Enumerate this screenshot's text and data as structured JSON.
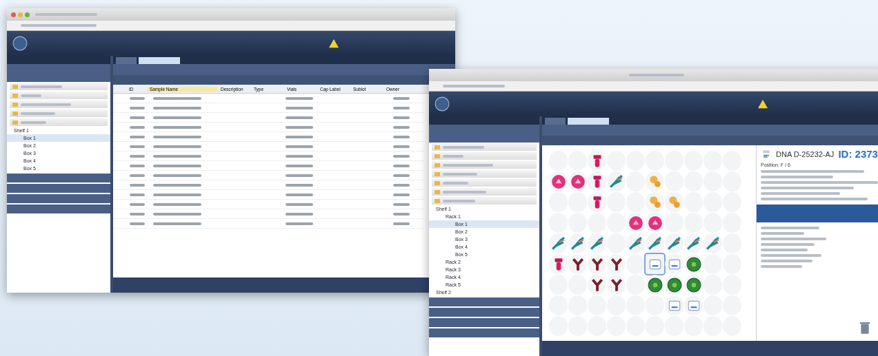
{
  "left_window": {
    "table": {
      "columns": [
        "ID",
        "Sample Name",
        "Description",
        "Type",
        "Vials",
        "Cap Label",
        "Sublot",
        "Owner"
      ]
    },
    "tree": [
      {
        "label": "Shelf 1",
        "children": [
          {
            "label": "Box 1",
            "selected": true
          },
          {
            "label": "Box 2",
            "selected": false
          },
          {
            "label": "Box 3",
            "selected": false
          },
          {
            "label": "Box 4",
            "selected": false
          },
          {
            "label": "Box 5",
            "selected": false
          }
        ]
      }
    ]
  },
  "right_window": {
    "tree": [
      {
        "label": "Shelf 1",
        "children": [
          {
            "label": "Rack 1",
            "children": [
              {
                "label": "Box 1",
                "selected": true
              },
              {
                "label": "Box 2",
                "selected": false
              },
              {
                "label": "Box 3",
                "selected": false
              },
              {
                "label": "Box 4",
                "selected": false
              },
              {
                "label": "Box 5",
                "selected": false
              }
            ]
          },
          {
            "label": "Rack 2"
          },
          {
            "label": "Rack 3"
          },
          {
            "label": "Rack 4"
          },
          {
            "label": "Rack 5"
          }
        ]
      },
      {
        "label": "Shelf 2"
      }
    ],
    "wells": [
      [
        {
          "kind": "empty",
          "selected": false
        },
        {
          "kind": "empty",
          "selected": false
        },
        {
          "kind": "tube",
          "selected": false
        },
        {
          "kind": "empty",
          "selected": false
        },
        {
          "kind": "empty",
          "selected": false
        },
        {
          "kind": "empty",
          "selected": false
        },
        {
          "kind": "empty",
          "selected": false
        },
        {
          "kind": "empty",
          "selected": false
        },
        {
          "kind": "empty",
          "selected": false
        },
        {
          "kind": "empty",
          "selected": false
        }
      ],
      [
        {
          "kind": "ball",
          "selected": false
        },
        {
          "kind": "ball",
          "selected": false
        },
        {
          "kind": "tube",
          "selected": false
        },
        {
          "kind": "leaf",
          "selected": false
        },
        {
          "kind": "empty",
          "selected": false
        },
        {
          "kind": "seed",
          "selected": false
        },
        {
          "kind": "empty",
          "selected": false
        },
        {
          "kind": "empty",
          "selected": false
        },
        {
          "kind": "empty",
          "selected": false
        },
        {
          "kind": "empty",
          "selected": false
        }
      ],
      [
        {
          "kind": "empty",
          "selected": false
        },
        {
          "kind": "empty",
          "selected": false
        },
        {
          "kind": "tube",
          "selected": false
        },
        {
          "kind": "empty",
          "selected": false
        },
        {
          "kind": "empty",
          "selected": false
        },
        {
          "kind": "seed",
          "selected": false
        },
        {
          "kind": "seed",
          "selected": false
        },
        {
          "kind": "empty",
          "selected": false
        },
        {
          "kind": "empty",
          "selected": false
        },
        {
          "kind": "empty",
          "selected": false
        }
      ],
      [
        {
          "kind": "empty",
          "selected": false
        },
        {
          "kind": "empty",
          "selected": false
        },
        {
          "kind": "empty",
          "selected": false
        },
        {
          "kind": "empty",
          "selected": false
        },
        {
          "kind": "ball",
          "selected": false
        },
        {
          "kind": "ball",
          "selected": false
        },
        {
          "kind": "empty",
          "selected": false
        },
        {
          "kind": "empty",
          "selected": false
        },
        {
          "kind": "empty",
          "selected": false
        },
        {
          "kind": "empty",
          "selected": false
        }
      ],
      [
        {
          "kind": "leaf",
          "selected": false
        },
        {
          "kind": "leaf",
          "selected": false
        },
        {
          "kind": "leaf",
          "selected": false
        },
        {
          "kind": "empty",
          "selected": false
        },
        {
          "kind": "leaf",
          "selected": false
        },
        {
          "kind": "leaf",
          "selected": false
        },
        {
          "kind": "leaf",
          "selected": false
        },
        {
          "kind": "leaf",
          "selected": false
        },
        {
          "kind": "leaf",
          "selected": false
        },
        {
          "kind": "empty",
          "selected": false
        }
      ],
      [
        {
          "kind": "tube",
          "selected": false
        },
        {
          "kind": "antibody",
          "selected": false
        },
        {
          "kind": "antibody",
          "selected": false
        },
        {
          "kind": "antibody",
          "selected": false
        },
        {
          "kind": "empty",
          "selected": false
        },
        {
          "kind": "label",
          "selected": true
        },
        {
          "kind": "label",
          "selected": false
        },
        {
          "kind": "cell",
          "selected": false
        },
        {
          "kind": "empty",
          "selected": false
        },
        {
          "kind": "empty",
          "selected": false
        }
      ],
      [
        {
          "kind": "empty",
          "selected": false
        },
        {
          "kind": "empty",
          "selected": false
        },
        {
          "kind": "antibody",
          "selected": false
        },
        {
          "kind": "antibody",
          "selected": false
        },
        {
          "kind": "empty",
          "selected": false
        },
        {
          "kind": "cell",
          "selected": false
        },
        {
          "kind": "cell",
          "selected": false
        },
        {
          "kind": "cell",
          "selected": false
        },
        {
          "kind": "empty",
          "selected": false
        },
        {
          "kind": "empty",
          "selected": false
        }
      ],
      [
        {
          "kind": "empty",
          "selected": false
        },
        {
          "kind": "empty",
          "selected": false
        },
        {
          "kind": "empty",
          "selected": false
        },
        {
          "kind": "empty",
          "selected": false
        },
        {
          "kind": "empty",
          "selected": false
        },
        {
          "kind": "empty",
          "selected": false
        },
        {
          "kind": "label",
          "selected": false
        },
        {
          "kind": "label",
          "selected": false
        },
        {
          "kind": "empty",
          "selected": false
        },
        {
          "kind": "empty",
          "selected": false
        }
      ],
      [
        {
          "kind": "empty",
          "selected": false
        },
        {
          "kind": "empty",
          "selected": false
        },
        {
          "kind": "empty",
          "selected": false
        },
        {
          "kind": "empty",
          "selected": false
        },
        {
          "kind": "empty",
          "selected": false
        },
        {
          "kind": "empty",
          "selected": false
        },
        {
          "kind": "empty",
          "selected": false
        },
        {
          "kind": "empty",
          "selected": false
        },
        {
          "kind": "empty",
          "selected": false
        },
        {
          "kind": "empty",
          "selected": false
        }
      ]
    ],
    "detail": {
      "title": "DNA D-25232-AJ",
      "id": "ID: 2373",
      "position": "Position: F / 6"
    }
  }
}
